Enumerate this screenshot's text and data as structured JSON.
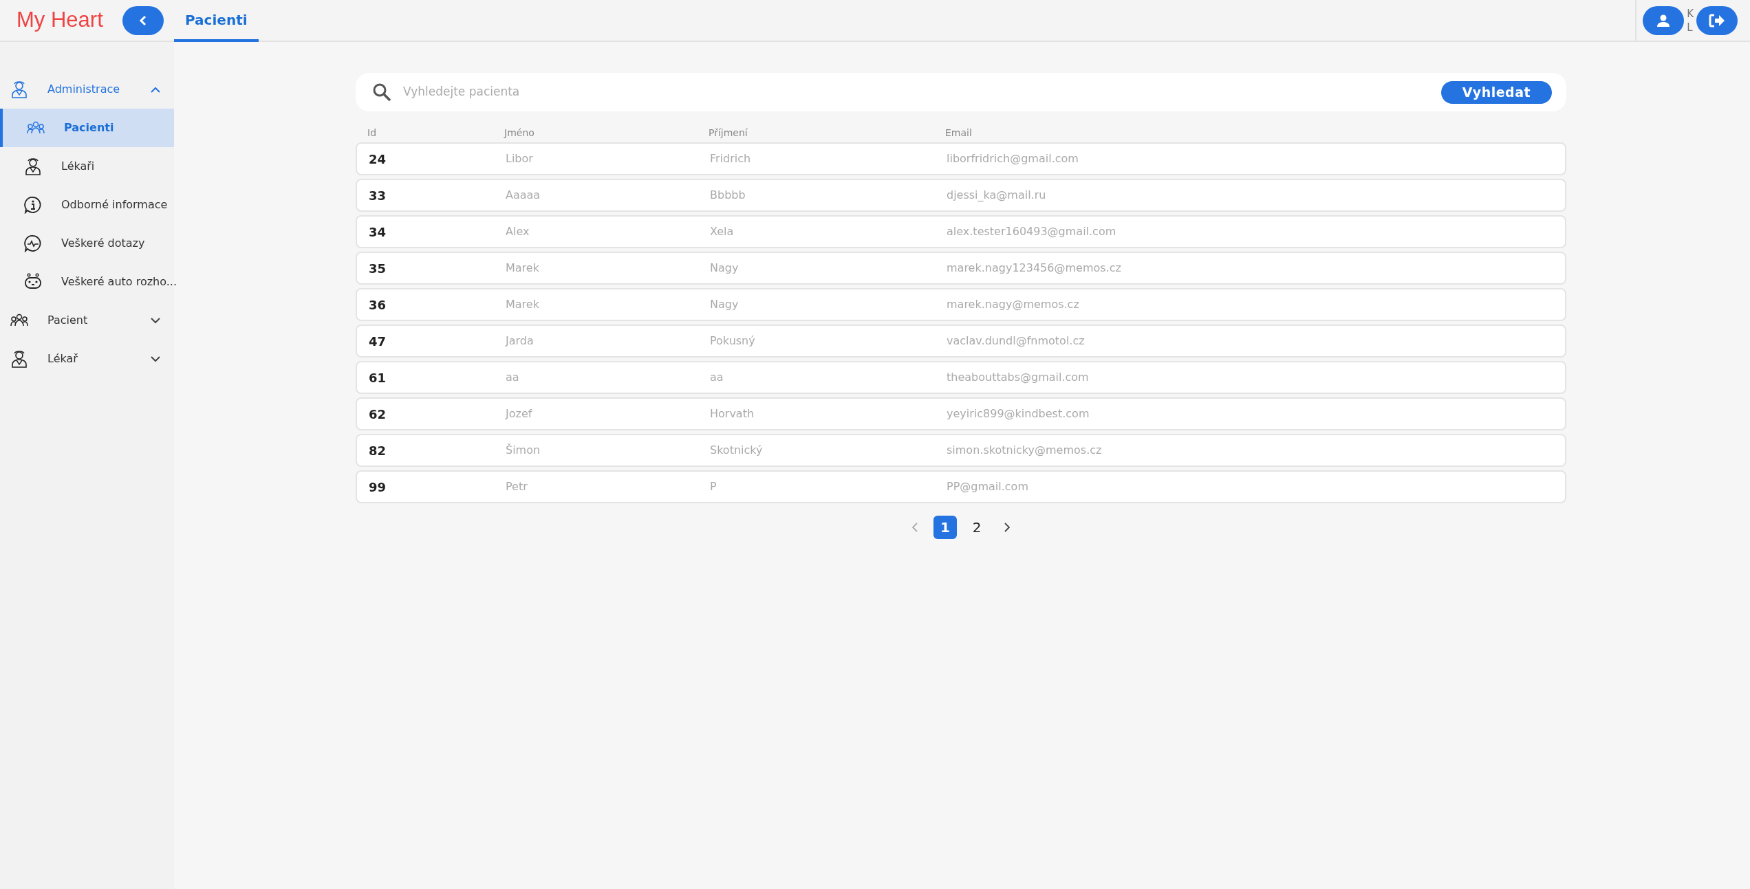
{
  "app": {
    "logo": "My Heart"
  },
  "header": {
    "tabs": [
      {
        "label": "Pacienti",
        "selected": true
      }
    ],
    "user_initials": [
      "K",
      "L"
    ]
  },
  "sidebar": {
    "items": [
      {
        "label": "Administrace",
        "kind": "doctor",
        "expanded": true,
        "selected": false,
        "children": [
          {
            "label": "Pacienti",
            "kind": "group",
            "selected": true
          },
          {
            "label": "Lékaři",
            "kind": "doctor",
            "selected": false
          },
          {
            "label": "Odborné informace",
            "kind": "info",
            "selected": false
          },
          {
            "label": "Veškeré dotazy",
            "kind": "pulse",
            "selected": false
          },
          {
            "label": "Veškeré auto rozho...",
            "kind": "bot",
            "selected": false
          }
        ]
      },
      {
        "label": "Pacient",
        "kind": "group",
        "expanded": false,
        "selected": false
      },
      {
        "label": "Lékař",
        "kind": "doctor",
        "expanded": false,
        "selected": false
      }
    ]
  },
  "search": {
    "placeholder": "Vyhledejte pacienta",
    "button": "Vyhledat"
  },
  "table": {
    "columns": [
      "Id",
      "Jméno",
      "Příjmení",
      "Email"
    ],
    "rows": [
      [
        "24",
        "Libor",
        "Fridrich",
        "liborfridrich@gmail.com"
      ],
      [
        "33",
        "Aaaaa",
        "Bbbbb",
        "djessi_ka@mail.ru"
      ],
      [
        "34",
        "Alex",
        "Xela",
        "alex.tester160493@gmail.com"
      ],
      [
        "35",
        "Marek",
        "Nagy",
        "marek.nagy123456@memos.cz"
      ],
      [
        "36",
        "Marek",
        "Nagy",
        "marek.nagy@memos.cz"
      ],
      [
        "47",
        "Jarda",
        "Pokusný",
        "vaclav.dundl@fnmotol.cz"
      ],
      [
        "61",
        "aa",
        "aa",
        "theabouttabs@gmail.com"
      ],
      [
        "62",
        "Jozef",
        "Horvath",
        "yeyiric899@kindbest.com"
      ],
      [
        "82",
        "Šimon",
        "Skotnický",
        "simon.skotnicky@memos.cz"
      ],
      [
        "99",
        "Petr",
        "P",
        "PP@gmail.com"
      ]
    ]
  },
  "pagination": {
    "pages": [
      {
        "label": "1",
        "selected": true
      },
      {
        "label": "2",
        "selected": false
      }
    ],
    "prev_disabled": true,
    "next_disabled": false
  }
}
